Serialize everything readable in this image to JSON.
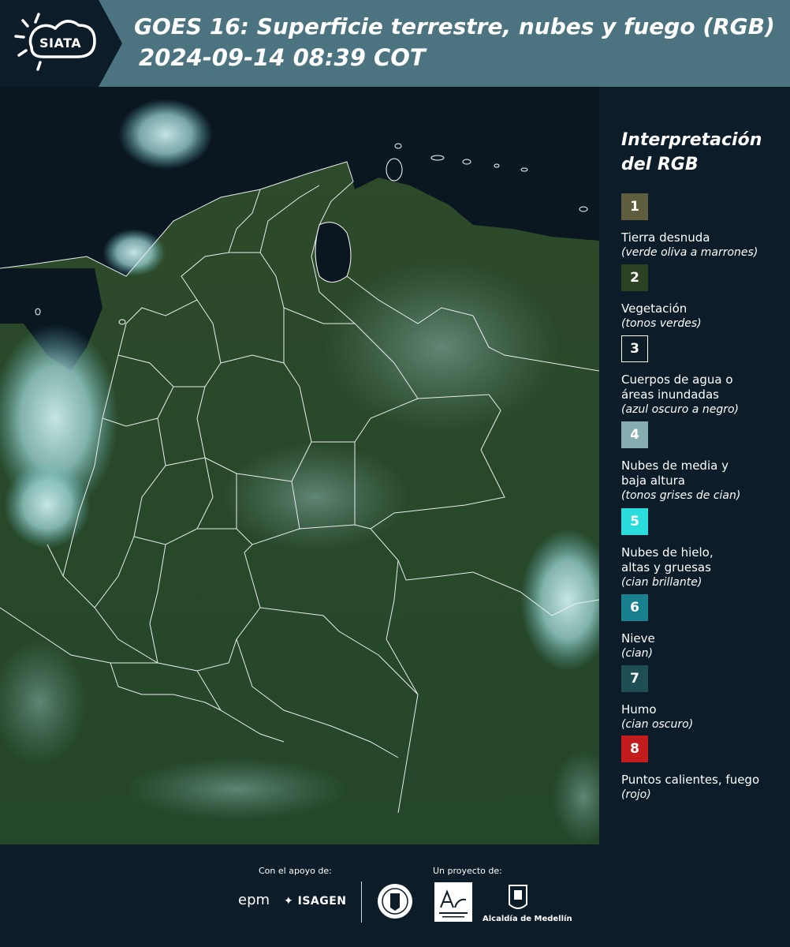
{
  "header": {
    "logo_text": "SIATA",
    "title_line1": "GOES 16: Superficie terrestre, nubes y fuego (RGB)",
    "title_line2": "2024-09-14 08:39 COT"
  },
  "legend": {
    "title_line1": "Interpretación",
    "title_line2": "del RGB",
    "items": [
      {
        "number": "1",
        "color": "#5e5e3f",
        "label_lines": [
          "Tierra desnuda"
        ],
        "note": "(verde oliva a marrones)"
      },
      {
        "number": "2",
        "color": "#2c4222",
        "label_lines": [
          "Vegetación"
        ],
        "note": "(tonos verdes)"
      },
      {
        "number": "3",
        "color": "#0c1c28",
        "label_lines": [
          "Cuerpos de agua o",
          "áreas inundadas"
        ],
        "note": "(azul oscuro a negro)"
      },
      {
        "number": "4",
        "color": "#86aeb0",
        "label_lines": [
          "Nubes de media y",
          "baja altura"
        ],
        "note": "(tonos grises de cian)"
      },
      {
        "number": "5",
        "color": "#2bdcdc",
        "label_lines": [
          "Nubes de hielo,",
          "altas y gruesas"
        ],
        "note": "(cian brillante)"
      },
      {
        "number": "6",
        "color": "#19808f",
        "label_lines": [
          "Nieve"
        ],
        "note": "(cian)"
      },
      {
        "number": "7",
        "color": "#1f4f55",
        "label_lines": [
          "Humo"
        ],
        "note": "(cian oscuro)"
      },
      {
        "number": "8",
        "color": "#c21c1c",
        "label_lines": [
          "Puntos calientes, fuego"
        ],
        "note": "(rojo)"
      }
    ]
  },
  "footer": {
    "support_label": "Con el apoyo de:",
    "project_label": "Un proyecto de:",
    "epm": "epm",
    "isagen": "ISAGEN",
    "medellin": "Alcaldía de Medellín"
  }
}
